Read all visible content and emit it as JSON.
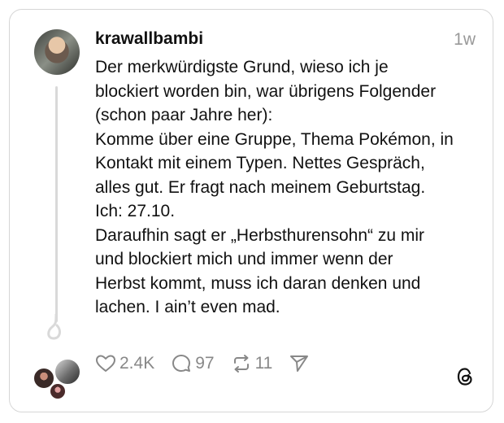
{
  "post": {
    "username": "krawallbambi",
    "time": "1w",
    "lines": [
      "Der merkwürdigste Grund, wieso ich je",
      "blockiert worden bin, war übrigens Folgender",
      "(schon paar Jahre her):",
      "Komme über eine Gruppe, Thema Pokémon, in",
      "Kontakt mit einem Typen. Nettes Gespräch,",
      "alles gut. Er fragt nach meinem Geburtstag.",
      "Ich: 27.10.",
      "Daraufhin sagt er „Herbsthurensohn“ zu mir",
      "und blockiert mich und immer wenn der",
      "Herbst kommt, muss ich daran denken und",
      "lachen. I ain’t even mad."
    ]
  },
  "actions": {
    "likes": "2.4K",
    "comments": "97",
    "reposts": "11"
  },
  "icons": {
    "like": "heart-icon",
    "comment": "comment-bubble-icon",
    "repost": "repost-icon",
    "share": "send-icon",
    "logo": "threads-logo-icon"
  }
}
